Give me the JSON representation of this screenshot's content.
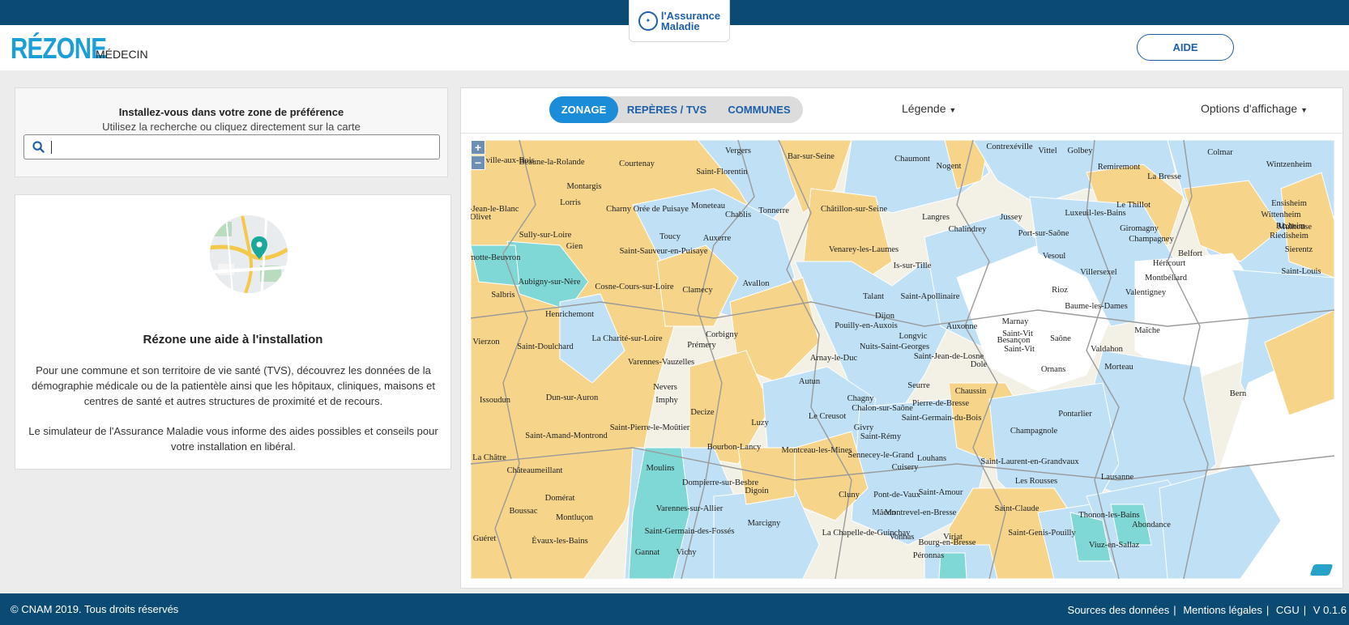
{
  "header": {
    "brand": "RÉZONE",
    "profession": "MÉDECIN",
    "partner_logo": "l'Assurance Maladie",
    "partner_logo_line1": "l'Assurance",
    "partner_logo_line2": "Maladie",
    "help_label": "AIDE"
  },
  "search": {
    "title": "Installez-vous dans votre zone de préférence",
    "subtitle": "Utilisez la recherche ou cliquez directement sur la carte",
    "placeholder": "",
    "value": ""
  },
  "info": {
    "title": "Rézone une aide à l'installation",
    "paragraph1": "Pour une commune et son territoire de vie santé (TVS), découvrez les données de la démographie médicale ou de la patientèle ainsi que les hôpitaux, cliniques, maisons et centres de santé et autres structures de proximité et de recours.",
    "paragraph2": "Le simulateur de l'Assurance Maladie vous informe des aides possibles et conseils pour votre installation en libéral."
  },
  "map_toolbar": {
    "tabs": [
      {
        "label": "ZONAGE",
        "active": true
      },
      {
        "label": "REPÈRES / TVS",
        "active": false
      },
      {
        "label": "COMMUNES",
        "active": false
      }
    ],
    "legend_label": "Légende",
    "display_options_label": "Options d'affichage",
    "zoom_in": "+",
    "zoom_out": "−"
  },
  "map": {
    "colors": {
      "yellow": "#f6d58b",
      "blue": "#bfe0f5",
      "teal": "#7fd8d6",
      "white": "#ffffff",
      "border": "#9a9a9a"
    },
    "labels": [
      "Neuville-aux-Bois",
      "Beaune-la-Rolande",
      "Courtenay",
      "Vergers",
      "Bar-sur-Seine",
      "Chaumont",
      "Nogent",
      "Contrexéville",
      "Vittel",
      "Golbey",
      "Remiremont",
      "Colmar",
      "Wintzenheim",
      "Saint-Florentin",
      "Montargis",
      "Saint-Jean-le-Blanc",
      "Olivet",
      "Lorris",
      "Charny Orée de Puisaye",
      "Moneteau",
      "Chablis",
      "Tonnerre",
      "Châtillon-sur-Seine",
      "Langres",
      "Chalindrey",
      "Jussey",
      "Luxeuil-les-Bains",
      "Le Thillot",
      "La Bresse",
      "Ensisheim",
      "Wittenheim",
      "Riedisheim",
      "Mulhouse",
      "Rixheim",
      "Sierentz",
      "Sully-sur-Loire",
      "Gien",
      "Toucy",
      "Auxerre",
      "Saint-Sauveur-en-Puisaye",
      "Port-sur-Saône",
      "Giromagny",
      "Champagney",
      "Belfort",
      "Lamotte-Beuvron",
      "Aubigny-sur-Nère",
      "Vesoul",
      "Venarey-les-Laumes",
      "Is-sur-Tille",
      "Villersexel",
      "Héricourt",
      "Montbéliard",
      "Saint-Louis",
      "Salbris",
      "Cosne-Cours-sur-Loire",
      "Clamecy",
      "Avallon",
      "Talant",
      "Saint-Apollinaire",
      "Rioz",
      "Valentigney",
      "Henrichemont",
      "Dijon",
      "Auxonne",
      "Marnay",
      "Baume-les-Dames",
      "Pouilly-en-Auxois",
      "Corbigny",
      "Vierzon",
      "La Charité-sur-Loire",
      "Prémery",
      "Longvic",
      "Maîche",
      "Saint-Doulchard",
      "Arnay-le-Duc",
      "Nuits-Saint-Georges",
      "Saint-Jean-de-Losne",
      "Saint-Vit",
      "Saône",
      "Valdahon",
      "Dole",
      "Varennes-Vauzelles",
      "Ornans",
      "Morteau",
      "Nevers",
      "Imphy",
      "Autun",
      "Seurre",
      "Chaussin",
      "Saint-Vit",
      "Issoudun",
      "Dun-sur-Auron",
      "Chagny",
      "Chalon-sur-Saône",
      "Pierre-de-Bresse",
      "Saint-Germain-du-Bois",
      "Pontarlier",
      "Le Creusot",
      "Decize",
      "Luzy",
      "Saint-Pierre-le-Moûtier",
      "Givry",
      "Saint-Rémy",
      "Champagnole",
      "Saint-Amand-Montrond",
      "Bourbon-Lancy",
      "Montceau-les-Mines",
      "Sennecey-le-Grand",
      "La Châtre",
      "Châteaumeillant",
      "Louhans",
      "Cuisery",
      "Saint-Laurent-en-Grandvaux",
      "Les Rousses",
      "Moulins",
      "Dompierre-sur-Besbre",
      "Digoin",
      "Domérat",
      "Cluny",
      "Pont-de-Vaux",
      "Saint-Amour",
      "Saint-Claude",
      "Montluçon",
      "Varennes-sur-Allier",
      "Mâcon",
      "Montrevel-en-Bresse",
      "Thonon-les-Bains",
      "Abondance",
      "Guéret",
      "Évaux-les-Bains",
      "Saint-Germain-des-Fossés",
      "Marcigny",
      "La Chapelle-de-Guinchay",
      "Viriat",
      "Saint-Genis-Pouilly",
      "Vichy",
      "Gannat",
      "Vonnas",
      "Bourg-en-Bresse",
      "Viuz-en-Sallaz",
      "Péronnas",
      "Besançon",
      "Lausanne",
      "Bern",
      "Boussac"
    ]
  },
  "footer": {
    "copyright": "© CNAM 2019. Tous droits réservés",
    "links": [
      "Sources des données",
      "Mentions légales",
      "CGU",
      "V 0.1.6"
    ]
  }
}
